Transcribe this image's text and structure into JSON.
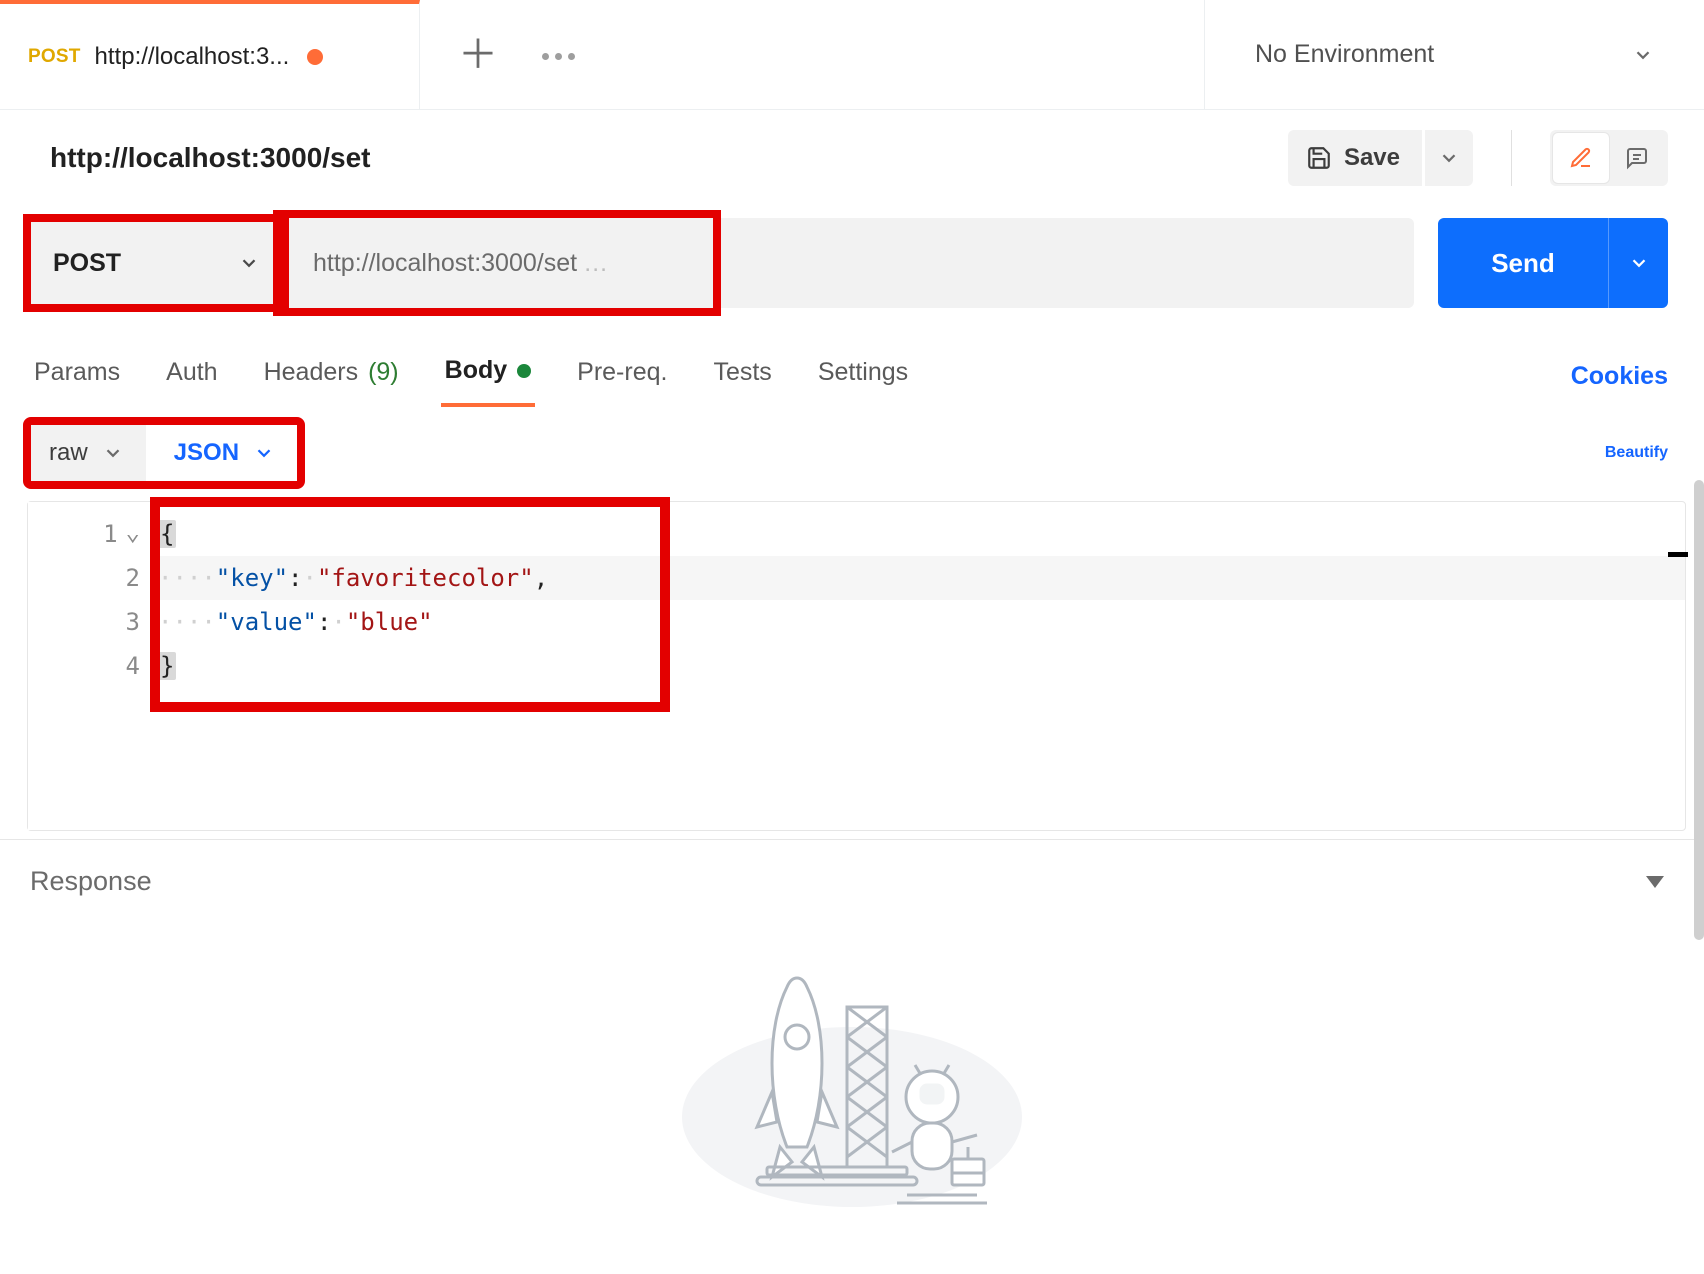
{
  "tab": {
    "method": "POST",
    "title": "http://localhost:3...",
    "dirty": true
  },
  "environment": {
    "selected": "No Environment"
  },
  "request": {
    "title": "http://localhost:3000/set",
    "method": "POST",
    "url": "http://localhost:3000/set",
    "send_label": "Send",
    "save_label": "Save"
  },
  "tabs": {
    "params": "Params",
    "auth": "Auth",
    "headers": "Headers",
    "headers_count": "(9)",
    "body": "Body",
    "prereq": "Pre-req.",
    "tests": "Tests",
    "settings": "Settings",
    "cookies": "Cookies"
  },
  "body_options": {
    "mode": "raw",
    "language": "JSON",
    "beautify": "Beautify"
  },
  "editor": {
    "lines": [
      "1",
      "2",
      "3",
      "4"
    ],
    "code_lines": {
      "l1_open": "{",
      "l2_key": "\"key\"",
      "l2_val": "\"favoritecolor\"",
      "l3_key": "\"value\"",
      "l3_val": "\"blue\"",
      "l4_close": "}"
    },
    "raw_body": "{\n    \"key\": \"favoritecolor\",\n    \"value\": \"blue\"\n}"
  },
  "response": {
    "label": "Response"
  }
}
